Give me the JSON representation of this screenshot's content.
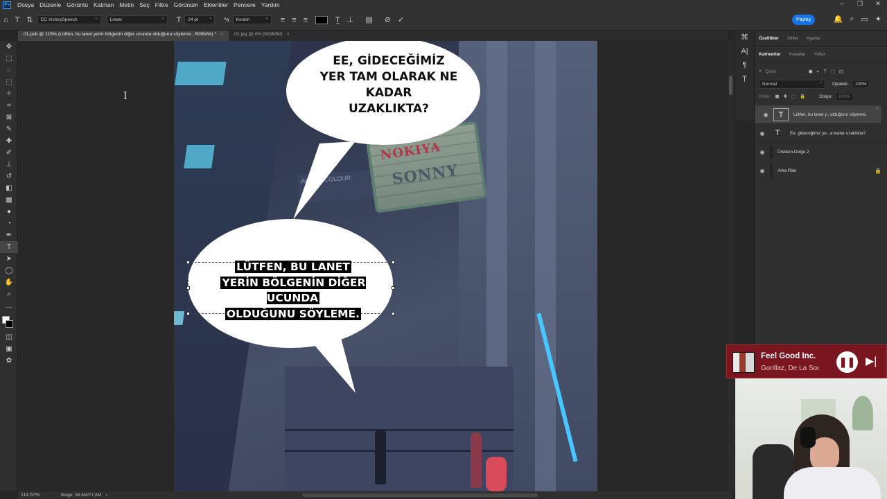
{
  "menu": {
    "logo": "Ps",
    "items": [
      "Dosya",
      "Düzenle",
      "Görüntü",
      "Katman",
      "Metin",
      "Seç",
      "Filtre",
      "Görünüm",
      "Eklentiler",
      "Pencere",
      "Yardım"
    ]
  },
  "options": {
    "font_family": "CC VictorySpeech",
    "font_style": "Lower",
    "font_size": "24 pt",
    "antialias_value": "Keskin",
    "text_color": "#000000",
    "share_label": "Paylaş"
  },
  "tabs": [
    {
      "label": "01.psb @ 115% (Lütfen, bu lanet yerin bölgenin diğer ucunda olduğunu söyleme., RGB/8#) *",
      "active": true
    },
    {
      "label": "01.jpg @ 4% (RGB/8#)",
      "active": false
    }
  ],
  "canvas": {
    "sign_line1": "NOKIYA",
    "sign_line2": "SONNY",
    "shop_sign": "ANCAK COLOUR",
    "bubble1_text": "EE, GİDECEĞİMİZ\nYER TAM OLARAK NE KADAR\nUZAKLIKTA?",
    "bubble2_lines": [
      "LÜTFEN, BU LANET",
      "YERİN BÖLGENİN DİĞER UCUNDA",
      "OLDUĞUNU SÖYLEME."
    ]
  },
  "status": {
    "zoom": "114.57%",
    "doc_size": "Belge: 38,6M/77,8M"
  },
  "panel": {
    "top_tabs": [
      "Özellikler",
      "Stiller",
      "Ayarlar"
    ],
    "layer_tabs": [
      "Katmanlar",
      "Kanallar",
      "Yollar"
    ],
    "filter_placeholder": "Çeşit",
    "blend_mode": "Normal",
    "opacity_label": "Opaklık:",
    "opacity_value": "100%",
    "lock_label": "Kilitle:",
    "fill_label": "Dolgu:",
    "fill_value": "100%",
    "layers": [
      {
        "name": "Lütfen, bu lanet y...olduğunu söyleme.",
        "type": "text",
        "selected": true
      },
      {
        "name": "Ee, gideceğimiz ye...e kadar uzaklıkta?",
        "type": "text",
        "selected": false
      },
      {
        "name": "Üretken Dolgu 2",
        "type": "fill",
        "selected": false
      },
      {
        "name": "Arka Plan",
        "type": "background",
        "selected": false
      }
    ]
  },
  "music": {
    "title": "Feel Good Inc.",
    "artist": "Gorillaz, De La Soul",
    "accent": "#7a1620"
  }
}
